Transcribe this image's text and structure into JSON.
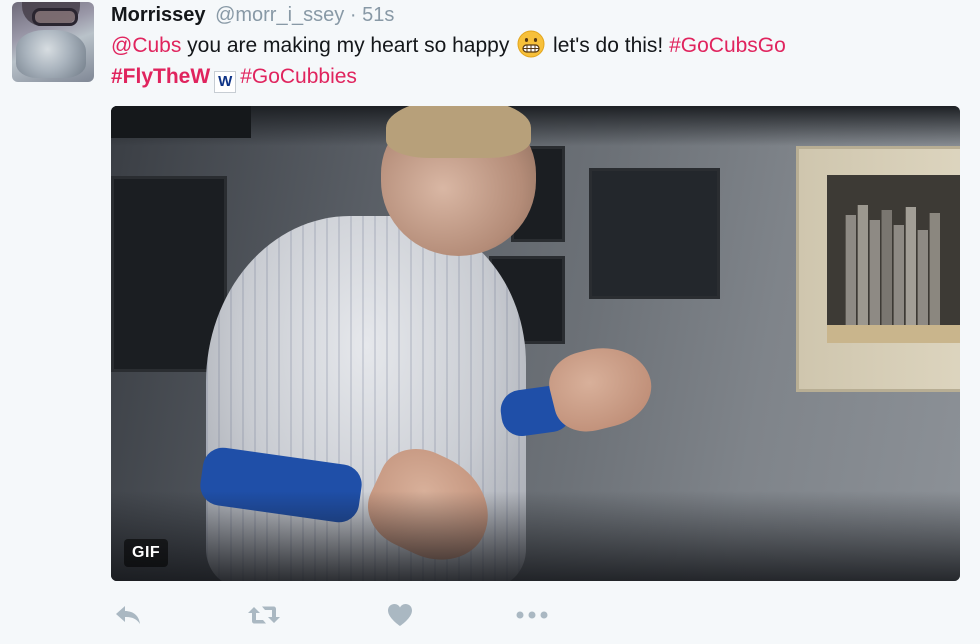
{
  "tweet": {
    "author": {
      "name": "Morrissey",
      "handle": "@morr_i_ssey",
      "separator": "·",
      "time": "51s"
    },
    "text": {
      "mention": "@Cubs",
      "part1": " you are making my heart so happy ",
      "part2": " let's do this! ",
      "hashtag1": "#GoCubsGo",
      "hashtag2": "#FlyTheW",
      "w_flag": "W",
      "hashtag3": "#GoCubbies"
    },
    "media": {
      "badge": "GIF"
    },
    "actions": {
      "reply_icon": "reply-icon",
      "retweet_icon": "retweet-icon",
      "like_icon": "heart-icon",
      "more_icon": "more-icon"
    }
  },
  "colors": {
    "link": "#e0245e",
    "muted": "#8899a6",
    "action_icon": "#aab8c2",
    "background": "#f5f8fa"
  }
}
